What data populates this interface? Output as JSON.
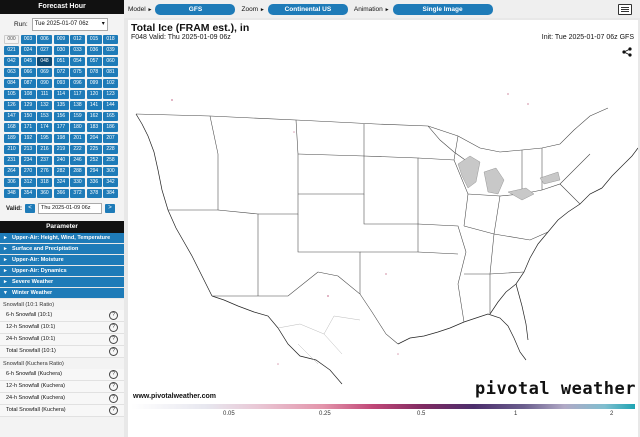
{
  "sidebar": {
    "forecast_header": "Forecast Hour",
    "run_label": "Run:",
    "run_value": "Tue 2025-01-07 06z",
    "hours": [
      "000",
      "003",
      "006",
      "009",
      "012",
      "015",
      "018",
      "021",
      "024",
      "027",
      "030",
      "033",
      "036",
      "039",
      "042",
      "045",
      "048",
      "051",
      "054",
      "057",
      "060",
      "063",
      "066",
      "069",
      "072",
      "075",
      "078",
      "081",
      "084",
      "087",
      "090",
      "093",
      "096",
      "099",
      "102",
      "105",
      "108",
      "111",
      "114",
      "117",
      "120",
      "123",
      "126",
      "129",
      "132",
      "135",
      "138",
      "141",
      "144",
      "147",
      "150",
      "153",
      "156",
      "159",
      "162",
      "165",
      "168",
      "171",
      "174",
      "177",
      "180",
      "183",
      "186",
      "189",
      "192",
      "195",
      "198",
      "201",
      "204",
      "207",
      "210",
      "213",
      "216",
      "219",
      "222",
      "225",
      "228",
      "231",
      "234",
      "237",
      "240",
      "246",
      "252",
      "258",
      "264",
      "270",
      "276",
      "282",
      "288",
      "294",
      "300",
      "306",
      "312",
      "318",
      "324",
      "330",
      "336",
      "342",
      "348",
      "354",
      "360",
      "366",
      "372",
      "378",
      "384"
    ],
    "selected_hour": "048",
    "valid_label": "Valid:",
    "prev_arrow": "<",
    "valid_value": "Thu 2025-01-09 06z",
    "next_arrow": ">",
    "parameter_header": "Parameter",
    "categories": [
      {
        "label": "Upper-Air: Height, Wind, Temperature",
        "icon": "triangle-right"
      },
      {
        "label": "Surface and Precipitation",
        "icon": "triangle-right"
      },
      {
        "label": "Upper-Air: Moisture",
        "icon": "triangle-right"
      },
      {
        "label": "Upper-Air: Dynamics",
        "icon": "triangle-right"
      },
      {
        "label": "Severe Weather",
        "icon": "triangle-right"
      },
      {
        "label": "Winter Weather",
        "icon": "triangle-down"
      }
    ],
    "subgroups": [
      {
        "title": "Snowfall (10:1 Ratio)",
        "items": [
          "6-h Snowfall (10:1)",
          "12-h Snowfall (10:1)",
          "24-h Snowfall (10:1)",
          "Total Snowfall (10:1)"
        ]
      },
      {
        "title": "Snowfall (Kuchera Ratio)",
        "items": [
          "6-h Snowfall (Kuchera)",
          "12-h Snowfall (Kuchera)",
          "24-h Snowfall (Kuchera)",
          "Total Snowfall (Kuchera)"
        ]
      }
    ]
  },
  "topbar": {
    "model_label": "Model",
    "model_value": "GFS",
    "zoom_label": "Zoom",
    "zoom_value": "Continental US",
    "animation_label": "Animation",
    "animation_value": "Single Image",
    "caret": "►",
    "help_glyph": "?",
    "icon": "keyboard-icon"
  },
  "map": {
    "title": "Total Ice (FRAM est.), in",
    "valid_line": "F048 Valid: Thu 2025-01-09 06z",
    "init_line": "Init: Tue 2025-01-07 06z GFS",
    "site_url": "www.pivotalweather.com",
    "brand": "pivotal weather",
    "colorbar_ticks": [
      "0.05",
      "0.25",
      "0.5",
      "1",
      "2"
    ],
    "colors": {
      "accent": "#1e7bb8",
      "header": "#111111",
      "selected": "#0c4a75"
    }
  }
}
